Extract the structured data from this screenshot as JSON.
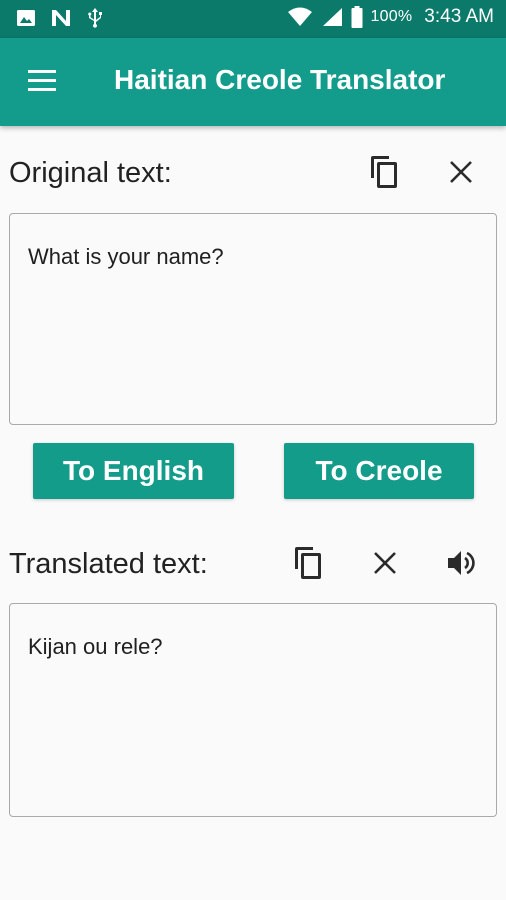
{
  "status_bar": {
    "battery_percent": "100%",
    "time": "3:43 AM",
    "icons": [
      "image-icon",
      "n-icon",
      "usb-icon",
      "wifi-icon",
      "signal-icon",
      "battery-icon"
    ]
  },
  "app_bar": {
    "title": "Haitian Creole Translator",
    "menu_icon": "menu-icon"
  },
  "original": {
    "label": "Original text:",
    "value": "What is your name?",
    "copy_icon": "copy-icon",
    "clear_icon": "close-icon"
  },
  "buttons": {
    "to_english": "To English",
    "to_creole": "To Creole"
  },
  "translated": {
    "label": "Translated text:",
    "value": "Kijan ou rele?",
    "copy_icon": "copy-icon",
    "clear_icon": "close-icon",
    "speak_icon": "speaker-icon"
  },
  "colors": {
    "status_bar": "#0b7a6b",
    "app_bar": "#139c8c",
    "button": "#149c8b",
    "background": "#fafafa"
  }
}
